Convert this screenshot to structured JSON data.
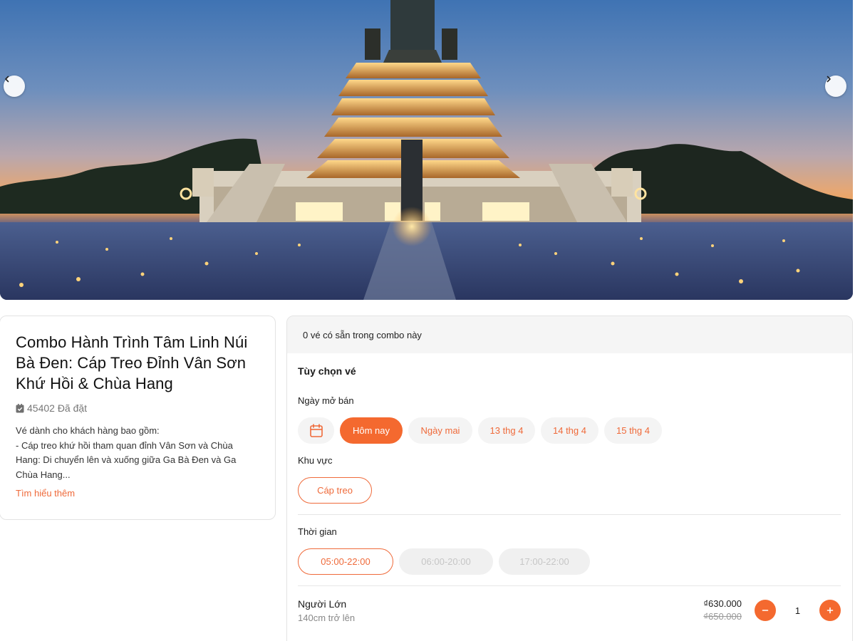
{
  "hero": {
    "prev_icon": "chevron-left-icon",
    "next_icon": "chevron-right-icon"
  },
  "info": {
    "title": "Combo Hành Trình Tâm Linh Núi Bà Đen: Cáp Treo Đỉnh Vân Sơn Khứ Hồi & Chùa Hang",
    "booked_icon": "ticket-check-icon",
    "booked_text": "45402 Đã đặt",
    "description": "Vé dành cho khách hàng bao gồm:\n- Cáp treo khứ hồi tham quan đỉnh Vân Sơn và Chùa Hang: Di chuyển lên và xuống giữa Ga Bà Đen và Ga Chùa Hang...",
    "learn_more": "Tìm hiểu thêm"
  },
  "panel": {
    "banner": "0 vé có sẵn trong combo này",
    "section_title": "Tùy chọn vé",
    "sale_date_label": "Ngày mở bán",
    "calendar_icon": "calendar-icon",
    "dates": [
      "Hôm nay",
      "Ngày mai",
      "13 thg 4",
      "14 thg 4",
      "15 thg 4"
    ],
    "selected_date": "Hôm nay",
    "area_label": "Khu vực",
    "area_option": "Cáp treo",
    "time_label": "Thời gian",
    "times": [
      "05:00-22:00",
      "06:00-20:00",
      "17:00-22:00"
    ],
    "selected_time": "05:00-22:00",
    "ticket": {
      "name": "Người Lớn",
      "sub": "140cm trở lên",
      "price_now": "₫630.000",
      "price_old": "₫650.000",
      "quantity": "1",
      "minus_icon": "minus-icon",
      "plus_icon": "plus-icon"
    }
  },
  "colors": {
    "accent": "#f4692f",
    "accent_text": "#ef6a3a"
  }
}
